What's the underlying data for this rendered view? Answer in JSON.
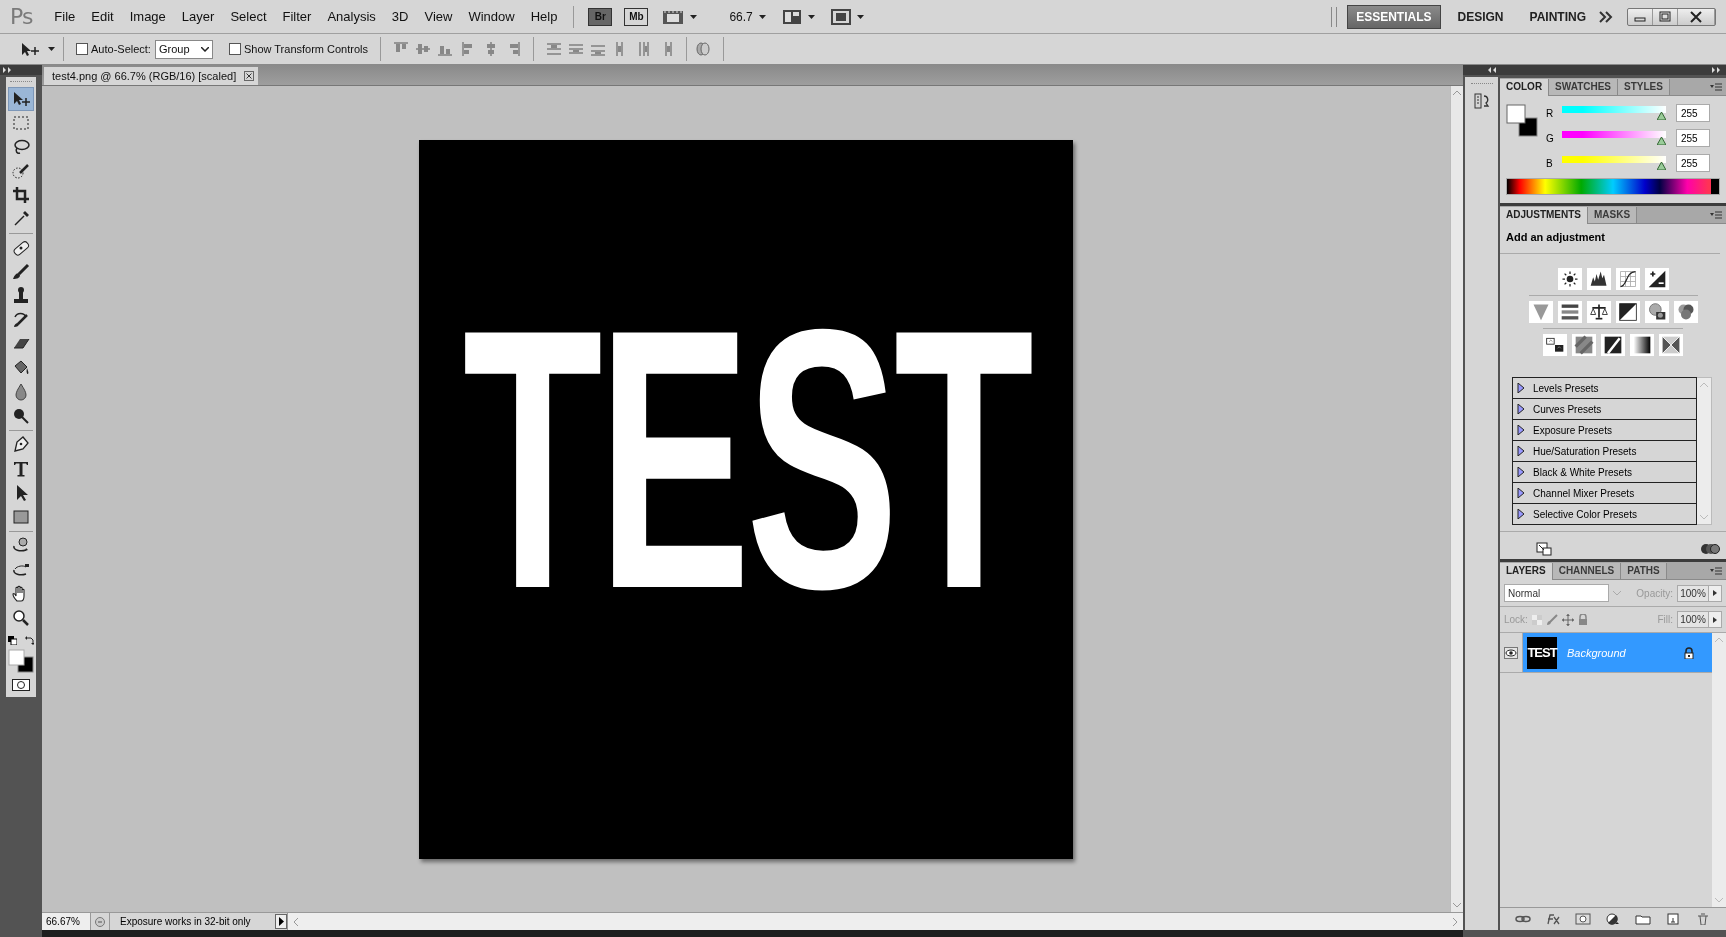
{
  "app_logo": "Ps",
  "menu": [
    "File",
    "Edit",
    "Image",
    "Layer",
    "Select",
    "Filter",
    "Analysis",
    "3D",
    "View",
    "Window",
    "Help"
  ],
  "app_bar": {
    "bridge": "Br",
    "mini_bridge": "Mb",
    "zoom": "66.7"
  },
  "workspaces": [
    {
      "label": "ESSENTIALS",
      "selected": true
    },
    {
      "label": "DESIGN",
      "selected": false
    },
    {
      "label": "PAINTING",
      "selected": false
    }
  ],
  "options": {
    "auto_select": {
      "label": "Auto-Select:",
      "checked": false
    },
    "auto_select_target": "Group",
    "transform_controls": {
      "label": "Show Transform Controls",
      "checked": false
    }
  },
  "tools": [
    {
      "selected": true
    },
    {
      "selected": false
    },
    {
      "selected": false
    },
    {
      "selected": false
    },
    {
      "selected": false
    },
    {
      "selected": false
    },
    {
      "selected": false
    },
    {
      "selected": false
    },
    {
      "selected": false
    },
    {
      "selected": false
    },
    {
      "selected": false
    },
    {
      "selected": false
    },
    {
      "selected": false
    },
    {
      "selected": false
    },
    {
      "selected": false
    },
    {
      "selected": false
    },
    {
      "selected": false
    },
    {
      "selected": false
    },
    {
      "selected": false
    },
    {
      "selected": false
    },
    {
      "selected": false
    },
    {
      "selected": false
    }
  ],
  "document": {
    "tab": "test4.png @ 66.7% (RGB/16) [scaled]",
    "canvas_text": "TEST"
  },
  "status_bar": {
    "zoom": "66.67%",
    "info": "Exposure works in 32-bit only"
  },
  "color_panel": {
    "tabs": [
      {
        "label": "COLOR",
        "selected": true
      },
      {
        "label": "SWATCHES",
        "selected": false
      },
      {
        "label": "STYLES",
        "selected": false
      }
    ],
    "channels": [
      {
        "label": "R",
        "value": "255",
        "level": 1,
        "color": "#00ffff"
      },
      {
        "label": "G",
        "value": "255",
        "level": 1,
        "color": "#ff00ff"
      },
      {
        "label": "B",
        "value": "255",
        "level": 1,
        "color": "#ffff00"
      }
    ]
  },
  "adjustments_panel": {
    "tabs": [
      {
        "label": "ADJUSTMENTS",
        "selected": true
      },
      {
        "label": "MASKS",
        "selected": false
      }
    ],
    "heading": "Add an adjustment",
    "presets": [
      {
        "label": "Levels Presets",
        "expanded": false
      },
      {
        "label": "Curves Presets",
        "expanded": false
      },
      {
        "label": "Exposure Presets",
        "expanded": false
      },
      {
        "label": "Hue/Saturation Presets",
        "expanded": false
      },
      {
        "label": "Black & White Presets",
        "expanded": false
      },
      {
        "label": "Channel Mixer Presets",
        "expanded": false
      },
      {
        "label": "Selective Color Presets",
        "expanded": false
      }
    ]
  },
  "layers_panel": {
    "tabs": [
      {
        "label": "LAYERS",
        "selected": true
      },
      {
        "label": "CHANNELS",
        "selected": false
      },
      {
        "label": "PATHS",
        "selected": false
      }
    ],
    "blend_mode": "Normal",
    "opacity_label": "Opacity:",
    "opacity": "100%",
    "lock_label": "Lock:",
    "fill_label": "Fill:",
    "fill": "100%",
    "layers": [
      {
        "name": "Background",
        "thumbnail_text": "TEST",
        "visible": true,
        "selected": true,
        "locked": true
      }
    ]
  }
}
